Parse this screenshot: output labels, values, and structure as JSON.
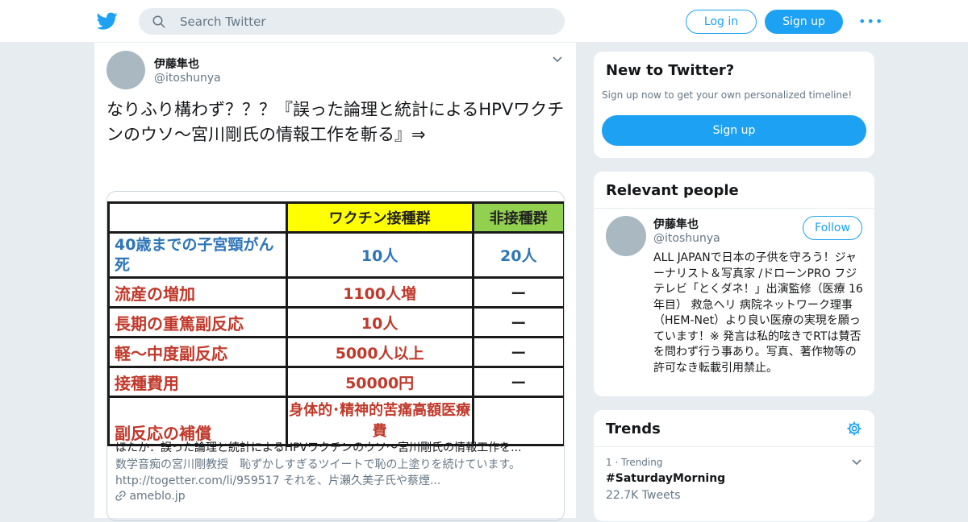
{
  "header": {
    "search_placeholder": "Search Twitter",
    "login_label": "Log in",
    "signup_label": "Sign up",
    "more_label": "•••",
    "brand_color": "#1da1f2"
  },
  "tweet": {
    "name": "伊藤隼也",
    "handle": "@itoshunya",
    "text": "なりふり構わず？？？『誤った論理と統計によるHPVワクチンのウソ～宮川剛氏の情報工作を斬る』⇒",
    "card": {
      "image_table": {
        "headers": [
          "",
          "ワクチン接種群",
          "非接種群"
        ],
        "rows": [
          [
            "40歳までの子宮頸がん死",
            "10人",
            "20人"
          ],
          [
            "流産の増加",
            "1100人増",
            "ー"
          ],
          [
            "長期の重篤副反応",
            "10人",
            "ー"
          ],
          [
            "軽～中度副反応",
            "5000人以上",
            "ー"
          ],
          [
            "接種費用",
            "50000円",
            "ー"
          ],
          [
            "副反応の補償",
            "身体的･精神的苦痛高額医療費",
            ""
          ]
        ]
      },
      "title": "ほたか：誤った論理と統計によるHPVワクチンのウソ～宮川剛氏の情報工作を...",
      "description": "数学音痴の宮川剛教授　恥ずかしすぎるツイートで恥の上塗りを続けています。\nhttp://togetter.com/li/959517 それを、片瀬久美子氏や蔡煙...",
      "domain": "ameblo.jp"
    }
  },
  "sidebar": {
    "new_to_twitter": {
      "title": "New to Twitter?",
      "subtitle": "Sign up now to get your own personalized timeline!",
      "button": "Sign up"
    },
    "relevant_people": {
      "title": "Relevant people",
      "name": "伊藤隼也",
      "handle": "@itoshunya",
      "follow_label": "Follow",
      "bio": "ALL JAPANで日本の子供を守ろう！ジャーナリスト＆写真家 /ドローンPRO フジテレビ「とくダネ！」出演監修（医療 16年目） 救急ヘリ 病院ネットワーク理事（HEM-Net）より良い医療の実現を願っています！※ 発言は私的呟きでRTは賛否を問わず行う事あり。写真、著作物等の許可なき転載引用禁止。"
    },
    "trends": {
      "title": "Trends",
      "items": [
        {
          "meta": "1 · Trending",
          "name": "#SaturdayMorning",
          "count": "22.7K Tweets"
        }
      ]
    }
  }
}
